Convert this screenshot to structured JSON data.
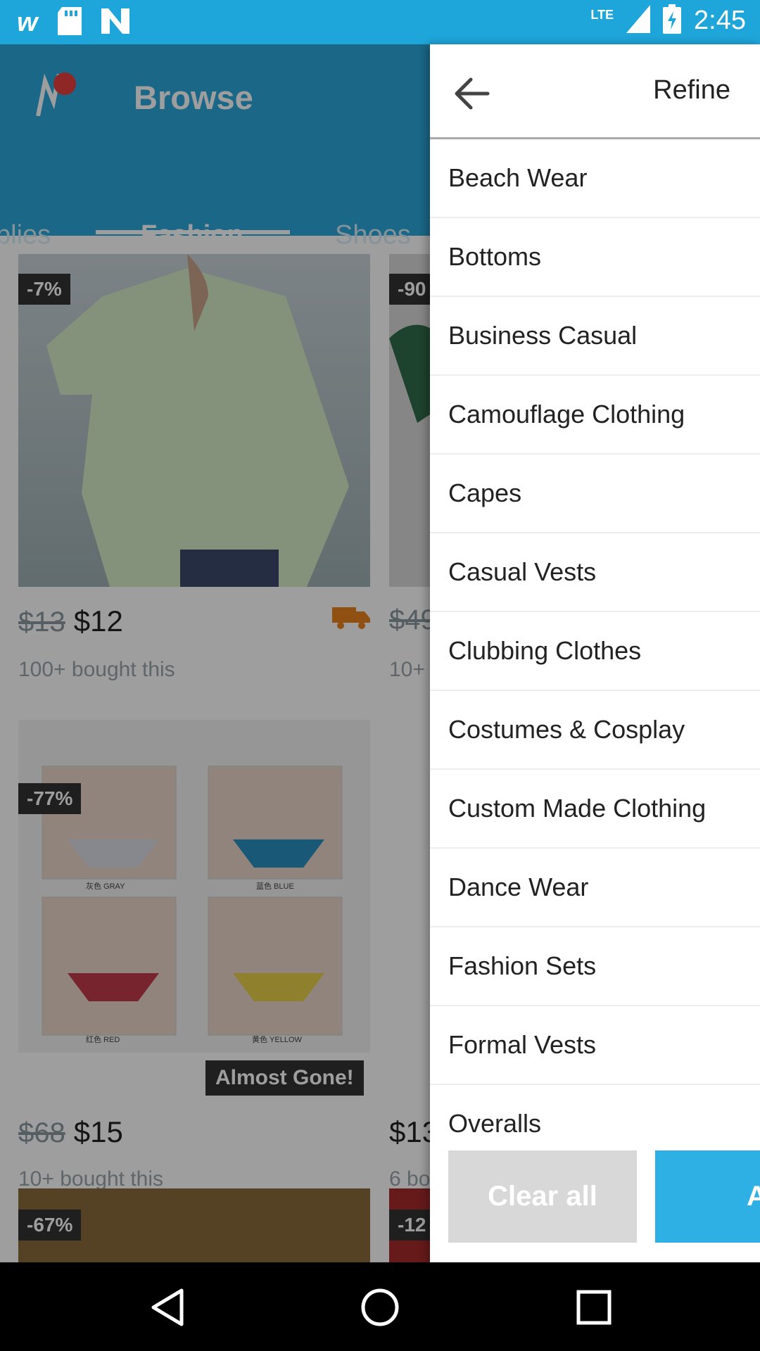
{
  "status_bar": {
    "time": "2:45",
    "network": "LTE",
    "icons": [
      "wish-icon",
      "sd-card-icon",
      "n-icon",
      "signal-icon",
      "battery-charging-icon"
    ]
  },
  "app": {
    "title": "Browse",
    "tabs": [
      {
        "label": "plies",
        "active": false
      },
      {
        "label": "Fashion",
        "active": true
      },
      {
        "label": "Shoes",
        "active": false
      }
    ],
    "products": [
      {
        "discount": "-7%",
        "price_old": "$13",
        "price_new": "$12",
        "bought": "100+ bought this"
      },
      {
        "discount": "-90",
        "price_old": "$49",
        "price_new": "",
        "bought": "10+"
      },
      {
        "discount": "-77%",
        "price_old": "$68",
        "price_new": "$15",
        "bought": "10+ bought this",
        "label": "Almost Gone!"
      },
      {
        "discount": "",
        "price_old": "",
        "price_new": "$13",
        "bought": "6 bo"
      },
      {
        "discount": "-67%"
      },
      {
        "discount": "-12"
      }
    ],
    "underwear_labels": [
      "灰色 GRAY",
      "蓝色 BLUE",
      "红色 RED",
      "黄色 YELLOW"
    ]
  },
  "drawer": {
    "title": "Refine",
    "items": [
      "Beach Wear",
      "Bottoms",
      "Business Casual",
      "Camouflage Clothing",
      "Capes",
      "Casual Vests",
      "Clubbing Clothes",
      "Costumes & Cosplay",
      "Custom Made Clothing",
      "Dance Wear",
      "Fashion Sets",
      "Formal Vests",
      "Overalls"
    ],
    "clear_label": "Clear all",
    "apply_label": "Apply"
  },
  "colors": {
    "brand": "#2aa7da",
    "status_bar": "#1ea6da",
    "apply_button": "#2fb0e5",
    "clear_button": "#d8d8d8",
    "shipping_icon": "#e8821e"
  }
}
